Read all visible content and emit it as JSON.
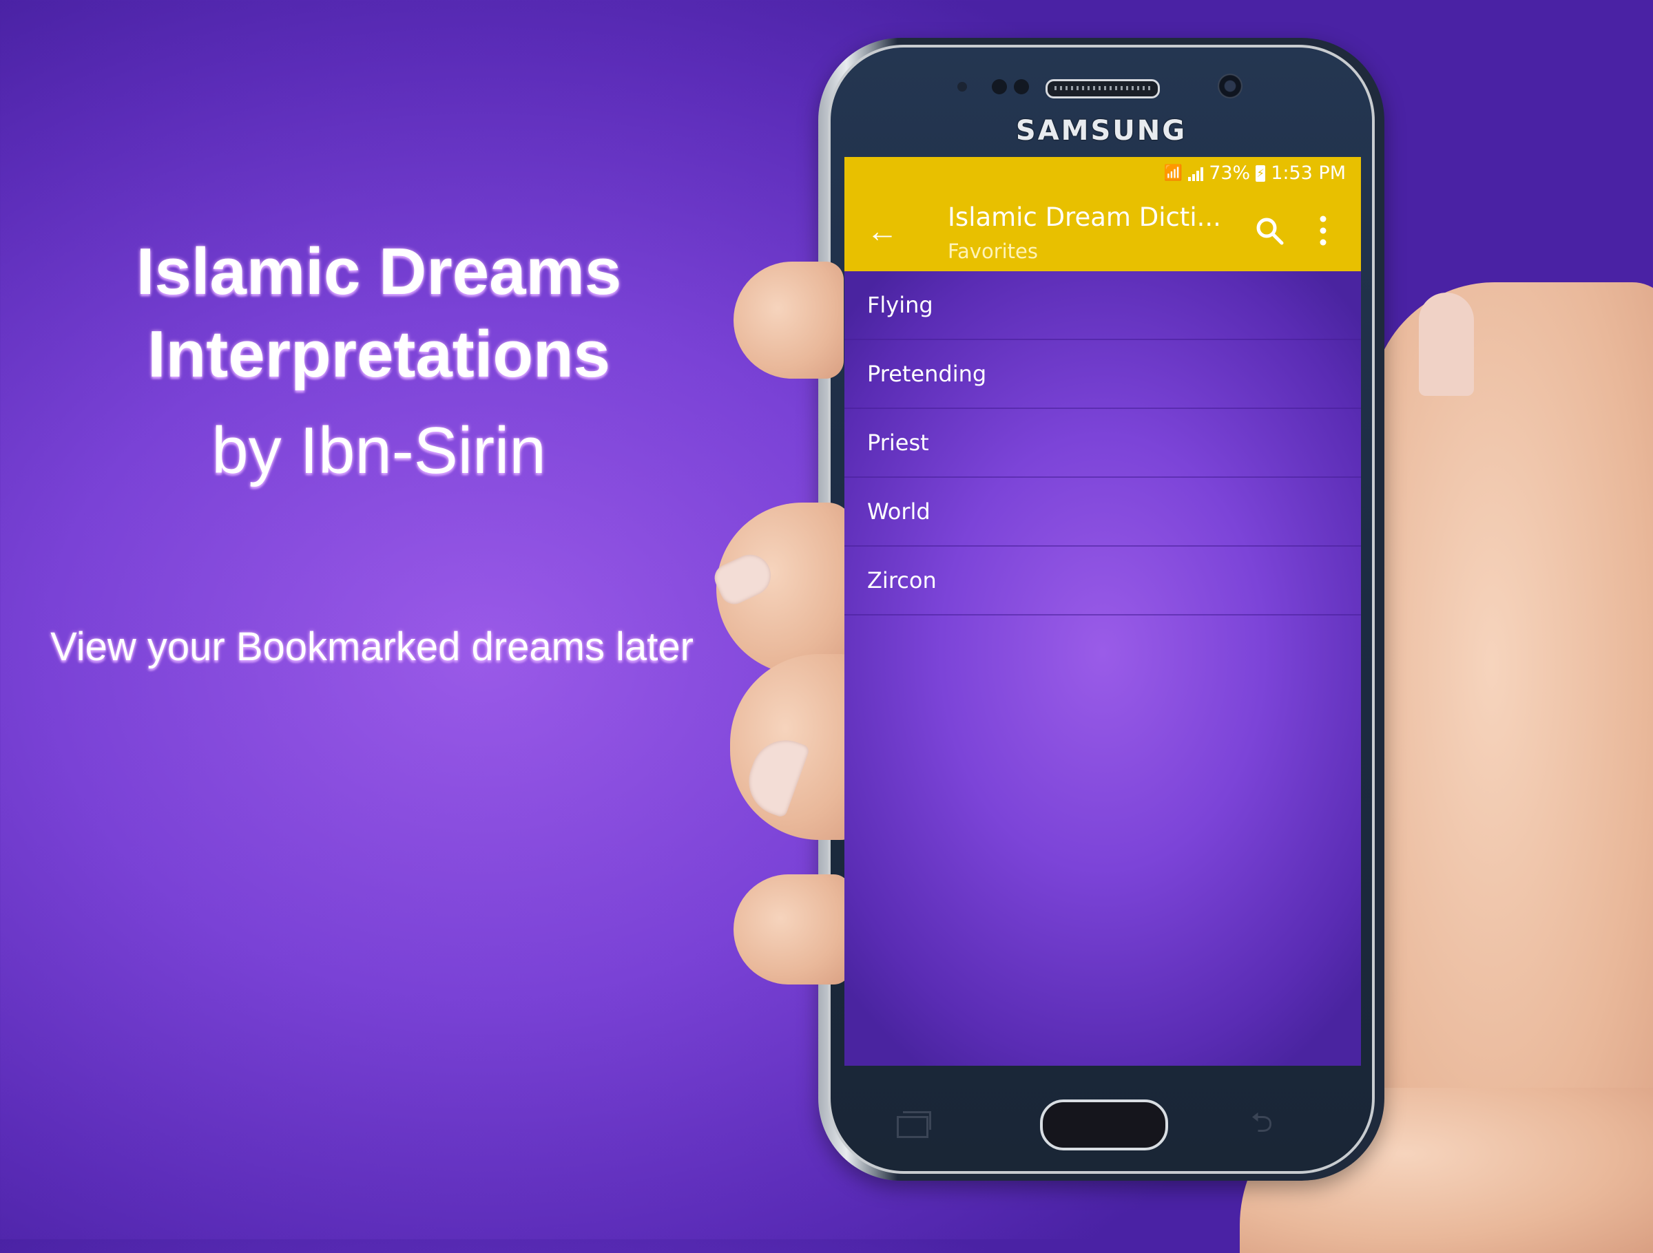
{
  "promo": {
    "title_line1": "Islamic Dreams",
    "title_line2": "Interpretations",
    "byline": "by Ibn-Sirin",
    "tagline": "View your Bookmarked dreams later"
  },
  "device": {
    "brand": "SAMSUNG"
  },
  "status_bar": {
    "battery": "73%",
    "time": "1:53 PM"
  },
  "app_bar": {
    "title": "Islamic Dream Dicti...",
    "subtitle": "Favorites",
    "color": "#e8c000"
  },
  "favorites": [
    {
      "label": "Flying"
    },
    {
      "label": "Pretending"
    },
    {
      "label": "Priest"
    },
    {
      "label": "World"
    },
    {
      "label": "Zircon"
    }
  ],
  "icons": {
    "back": "arrow-left",
    "search": "magnifier",
    "more": "vertical-dots",
    "wifi": "wifi",
    "signal": "signal-bars",
    "battery": "battery-charging"
  }
}
